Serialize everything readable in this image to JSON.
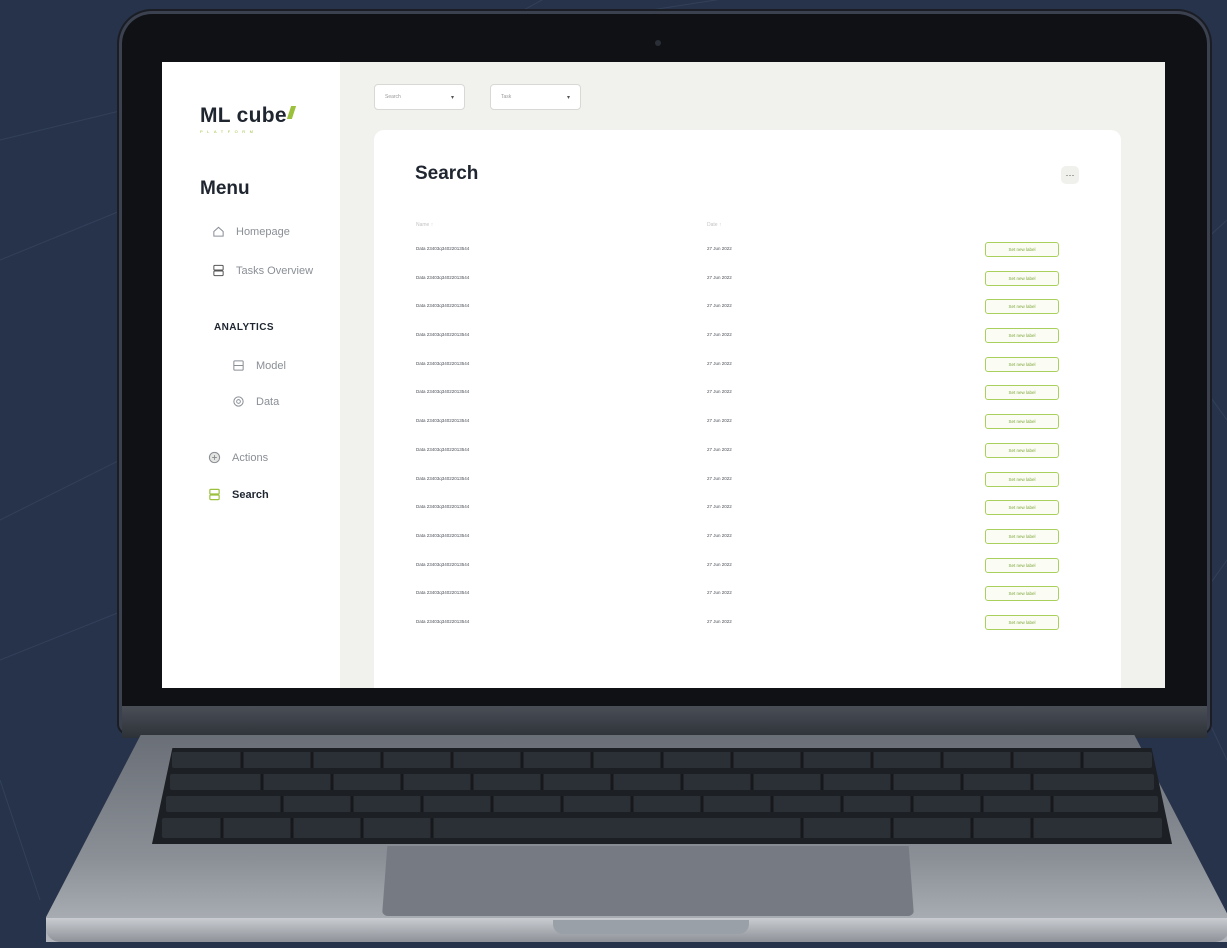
{
  "brand": {
    "name": "ML cube",
    "subtitle": "PLATFORM"
  },
  "sidebar": {
    "menu_title": "Menu",
    "items": [
      {
        "label": "Homepage",
        "icon": "home-icon"
      },
      {
        "label": "Tasks Overview",
        "icon": "tasks-icon"
      }
    ],
    "analytics_label": "ANALYTICS",
    "analytics_items": [
      {
        "label": "Model",
        "icon": "model-icon"
      },
      {
        "label": "Data",
        "icon": "data-icon"
      }
    ],
    "bottom_items": [
      {
        "label": "Actions",
        "icon": "actions-icon",
        "active": false
      },
      {
        "label": "Search",
        "icon": "search-icon",
        "active": true
      }
    ]
  },
  "filters": {
    "first": "Search",
    "second": "Task"
  },
  "main": {
    "title": "Search",
    "columns": [
      "Name",
      "Date"
    ],
    "rows": [
      {
        "name": "Data 23403q34022013544",
        "date": "27 Jun 2022",
        "action": "Set new label"
      },
      {
        "name": "Data 23403q34022013544",
        "date": "27 Jun 2022",
        "action": "Set new label"
      },
      {
        "name": "Data 23403q34022013544",
        "date": "27 Jun 2022",
        "action": "Set new label"
      },
      {
        "name": "Data 23403q34022013544",
        "date": "27 Jun 2022",
        "action": "Set new label"
      },
      {
        "name": "Data 23403q34022013544",
        "date": "27 Jun 2022",
        "action": "Set new label"
      },
      {
        "name": "Data 23403q34022013544",
        "date": "27 Jun 2022",
        "action": "Set new label"
      },
      {
        "name": "Data 23403q34022013544",
        "date": "27 Jun 2022",
        "action": "Set new label"
      },
      {
        "name": "Data 23403q34022013544",
        "date": "27 Jun 2022",
        "action": "Set new label"
      },
      {
        "name": "Data 23403q34022013544",
        "date": "27 Jun 2022",
        "action": "Set new label"
      },
      {
        "name": "Data 23403q34022013544",
        "date": "27 Jun 2022",
        "action": "Set new label"
      },
      {
        "name": "Data 23403q34022013544",
        "date": "27 Jun 2022",
        "action": "Set new label"
      },
      {
        "name": "Data 23403q34022013544",
        "date": "27 Jun 2022",
        "action": "Set new label"
      },
      {
        "name": "Data 23403q34022013544",
        "date": "27 Jun 2022",
        "action": "Set new label"
      },
      {
        "name": "Data 23403q34022013544",
        "date": "27 Jun 2022",
        "action": "Set new label"
      }
    ]
  },
  "colors": {
    "accent": "#9bc13c",
    "background": "#27334a",
    "text": "#1f2630"
  }
}
